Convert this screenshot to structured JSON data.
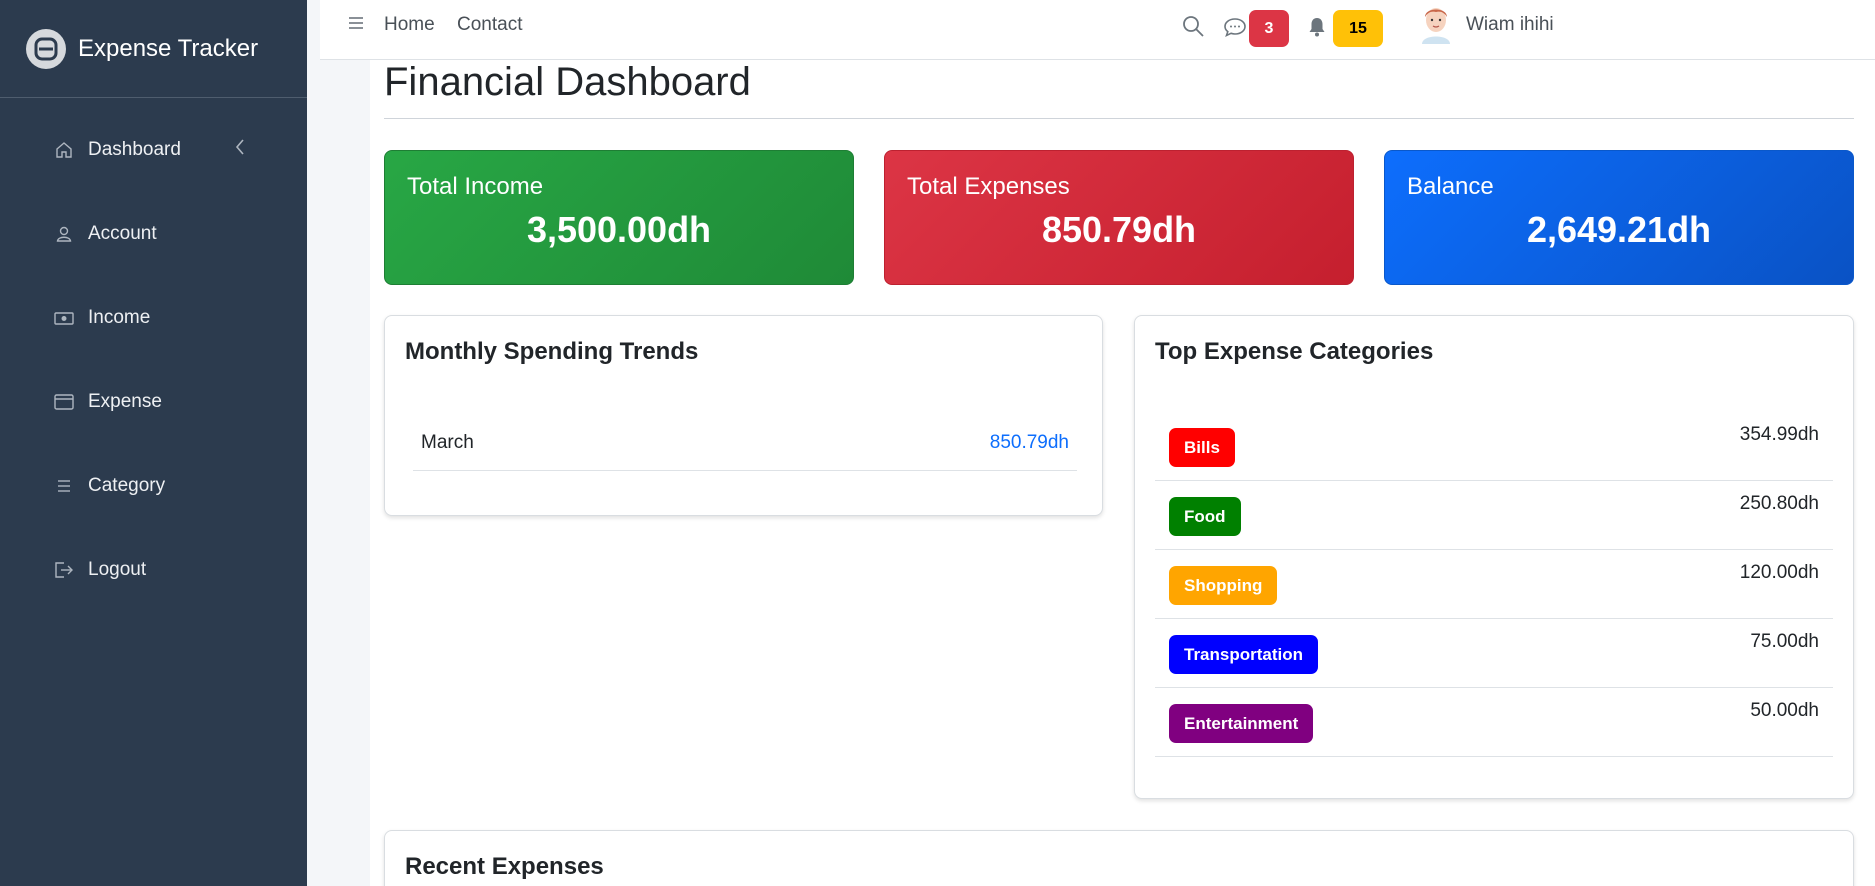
{
  "brand": {
    "title": "Expense Tracker"
  },
  "sidebar": {
    "items": [
      {
        "label": "Dashboard"
      },
      {
        "label": "Account"
      },
      {
        "label": "Income"
      },
      {
        "label": "Expense"
      },
      {
        "label": "Category"
      },
      {
        "label": "Logout"
      }
    ]
  },
  "topbar": {
    "home": "Home",
    "contact": "Contact",
    "messages_count": "3",
    "notifications_count": "15",
    "user_name": "Wiam ihihi"
  },
  "main": {
    "title": "Financial Dashboard",
    "stats": {
      "income_label": "Total Income",
      "income_value": "3,500.00dh",
      "expenses_label": "Total Expenses",
      "expenses_value": "850.79dh",
      "balance_label": "Balance",
      "balance_value": "2,649.21dh"
    },
    "trends": {
      "title": "Monthly Spending Trends",
      "rows": [
        {
          "month": "March",
          "amount": "850.79dh"
        }
      ]
    },
    "categories": {
      "title": "Top Expense Categories",
      "rows": [
        {
          "name": "Bills",
          "amount": "354.99dh",
          "color": "#ff0000"
        },
        {
          "name": "Food",
          "amount": "250.80dh",
          "color": "#008000"
        },
        {
          "name": "Shopping",
          "amount": "120.00dh",
          "color": "#ffa500"
        },
        {
          "name": "Transportation",
          "amount": "75.00dh",
          "color": "#0000ff"
        },
        {
          "name": "Entertainment",
          "amount": "50.00dh",
          "color": "#800080"
        }
      ]
    },
    "recent": {
      "title": "Recent Expenses"
    }
  },
  "colors": {
    "sidebar_bg": "#2c3b4e",
    "income": "#28a745",
    "expenses": "#dc3545",
    "balance": "#0d6efd",
    "accent_link": "#0d6efd"
  },
  "icons": {
    "brand": "logo-icon",
    "dashboard": "home-icon",
    "account": "user-icon",
    "income": "money-icon",
    "expense": "card-icon",
    "category": "list-icon",
    "logout": "logout-icon",
    "menu": "hamburger-icon",
    "search": "search-icon",
    "messages": "chat-icon",
    "notifications": "bell-icon",
    "collapse": "chevron-left-icon"
  }
}
